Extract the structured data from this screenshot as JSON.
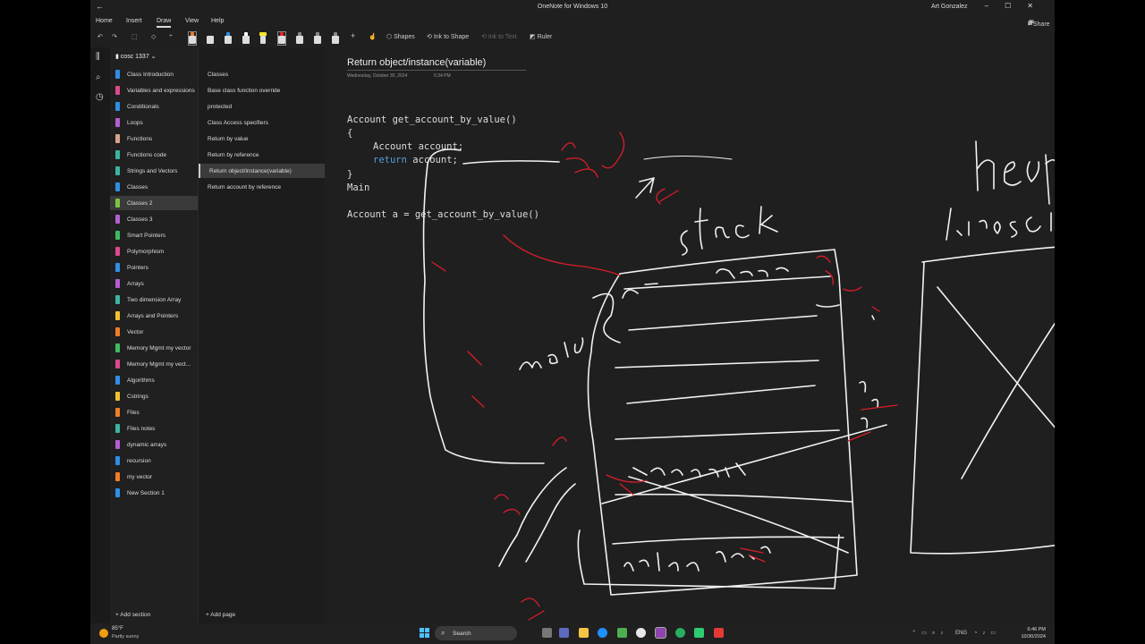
{
  "window": {
    "title": "OneNote for Windows 10",
    "user": "Art Gonzalez"
  },
  "menu": {
    "home": "Home",
    "insert": "Insert",
    "draw": "Draw",
    "view": "View",
    "help": "Help",
    "share": "Share"
  },
  "toolbar": {
    "shapes": "Shapes",
    "ink_to_shape": "Ink to Shape",
    "ink_to_text": "Ink to Text",
    "ruler": "Ruler"
  },
  "notebook": {
    "name": "cosc 1337"
  },
  "sections": [
    {
      "label": "Class Introduction",
      "color": "#2e8fe6"
    },
    {
      "label": "Variables and expressions",
      "color": "#e0488b"
    },
    {
      "label": "Conditionals",
      "color": "#2e8fe6"
    },
    {
      "label": "Loops",
      "color": "#b45fd1"
    },
    {
      "label": "Functions",
      "color": "#d6a58c"
    },
    {
      "label": "Functions code",
      "color": "#3db3a4"
    },
    {
      "label": "Strings and Vectors",
      "color": "#3db3a4"
    },
    {
      "label": "Classes",
      "color": "#2e8fe6"
    },
    {
      "label": "Classes 2",
      "color": "#7ec242"
    },
    {
      "label": "Classes 3",
      "color": "#b45fd1"
    },
    {
      "label": "Smart Pointers",
      "color": "#3dbb62"
    },
    {
      "label": "Polymorphism",
      "color": "#e0488b"
    },
    {
      "label": "Pointers",
      "color": "#2e8fe6"
    },
    {
      "label": "Arrays",
      "color": "#b45fd1"
    },
    {
      "label": "Two dimension Array",
      "color": "#3db3a4"
    },
    {
      "label": "Arrays and Pointers",
      "color": "#f2c12e"
    },
    {
      "label": "Vector",
      "color": "#f07d28"
    },
    {
      "label": "Memory Mgmt my vector",
      "color": "#3dbb62"
    },
    {
      "label": "Memory Mgmt my vect...",
      "color": "#e0488b"
    },
    {
      "label": "Algorithms",
      "color": "#2e8fe6"
    },
    {
      "label": "Cstrings",
      "color": "#f2c12e"
    },
    {
      "label": "Files",
      "color": "#f07d28"
    },
    {
      "label": "Files notes",
      "color": "#3db3a4"
    },
    {
      "label": "dynamic arrays",
      "color": "#b45fd1"
    },
    {
      "label": "recursion",
      "color": "#2e8fe6"
    },
    {
      "label": "my vector",
      "color": "#f07d28"
    },
    {
      "label": "New Section 1",
      "color": "#2e8fe6"
    }
  ],
  "selected_section": 8,
  "add_section": "Add section",
  "pages": [
    {
      "label": "Classes"
    },
    {
      "label": "Base class function override"
    },
    {
      "label": "protected"
    },
    {
      "label": "Class Access specifiers"
    },
    {
      "label": "Return by value"
    },
    {
      "label": "Return by reference"
    },
    {
      "label": "Return object/instance(variable)"
    },
    {
      "label": "Return account by reference"
    }
  ],
  "selected_page": 6,
  "add_page": "Add page",
  "page": {
    "title": "Return object/instance(variable)",
    "date": "Wednesday, October 30, 2024",
    "time": "6:34 PM",
    "code": {
      "line1": "Account get_account_by_value()",
      "line2": "{",
      "line3": "Account account;",
      "line4_kw": "return",
      "line4_rest": " account;",
      "line5": "}",
      "line6": "Main",
      "line7": "Account a = get_account_by_value()"
    }
  },
  "taskbar": {
    "temp": "85°F",
    "condition": "Partly sunny",
    "search": "Search",
    "lang": "ENG",
    "time": "6:46 PM",
    "date": "10/30/2024"
  }
}
